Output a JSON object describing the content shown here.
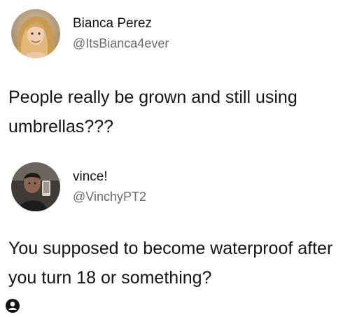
{
  "tweets": [
    {
      "display_name": "Bianca Perez",
      "handle": "@ItsBianca4ever",
      "text": "People really be grown and still using umbrellas???",
      "avatar_icon": "profile-photo-blonde-woman"
    },
    {
      "display_name": "vince!",
      "handle": "@VinchyPT2",
      "text": "You supposed to become waterproof after you turn 18 or something?",
      "avatar_icon": "profile-photo-man-dark-room"
    }
  ],
  "watermark_icon": "account-user-icon",
  "colors": {
    "text": "#141414",
    "handle": "#666b70",
    "background": "#ffffff"
  }
}
